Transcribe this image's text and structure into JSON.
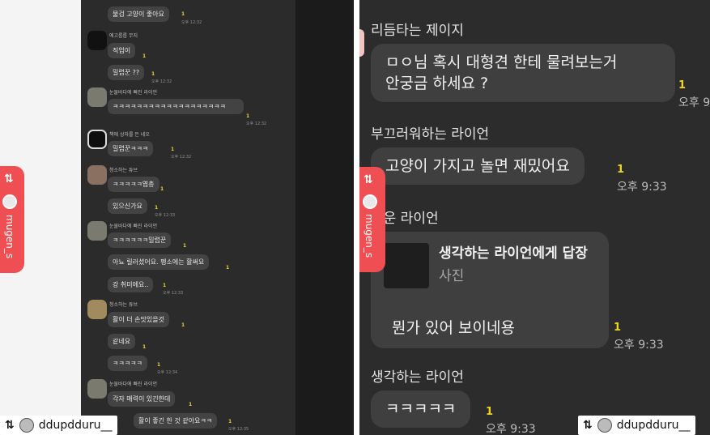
{
  "left": {
    "watermark": {
      "icon": "repost-icon",
      "handle": "mugen_s"
    },
    "repost_label": {
      "icon": "repost-icon",
      "handle": "ddupdduru__"
    },
    "items": [
      {
        "type": "msg",
        "text": "물검 고양이 좋아요",
        "unread": "1",
        "time": "오후 12:32"
      },
      {
        "type": "sender",
        "name": "예고롭롭 무지"
      },
      {
        "type": "msg",
        "text": "직업이",
        "unread": "1"
      },
      {
        "type": "msg",
        "text": "밀렵꾼 ??",
        "unread": "1",
        "time": "오후 12:32"
      },
      {
        "type": "sender",
        "name": "눈물바다에 빠진 라이언"
      },
      {
        "type": "msg",
        "text": "ㅋㅋㅋㅋㅋㅋㅋㅋㅋㅋㅋㅋㅋㅋㅋㅋㅋㅋㅋ",
        "unread": "1",
        "time": "오후 12:32"
      },
      {
        "type": "sender",
        "name": "책에 상자를 든 네오"
      },
      {
        "type": "msg",
        "text": "밀렵꾼ㅋㅋㅋ",
        "unread": "1",
        "time": "오후 12:32"
      },
      {
        "type": "sender",
        "name": "청소하는 튜브"
      },
      {
        "type": "msg",
        "text": "ㅋㅋㅋㅋㅋ엽총",
        "unread": "1"
      },
      {
        "type": "msg",
        "text": "있으신가요",
        "unread": "1",
        "time": "오후 12:33"
      },
      {
        "type": "sender",
        "name": "눈물바다에 빠진 라이언"
      },
      {
        "type": "msg",
        "text": "ㅋㅋㅋㅋㅋㅋ밀렵꾼",
        "unread": "1"
      },
      {
        "type": "msg",
        "text": "아뇨 릴러셨어요. 펭소에는 활써요",
        "unread": "1"
      },
      {
        "type": "msg",
        "text": "강 취미에요..",
        "unread": "1",
        "time": "오후 12:33"
      },
      {
        "type": "sender",
        "name": "청소하는 튜브"
      },
      {
        "type": "msg",
        "text": "활이 더 손맛있을것",
        "unread": "1"
      },
      {
        "type": "msg",
        "text": "같네요",
        "unread": "1"
      },
      {
        "type": "msg",
        "text": "ㅋㅋㅋㅋㅋ",
        "unread": "1",
        "time": "오후 12:34"
      },
      {
        "type": "sender",
        "name": "눈물바다에 빠진 라이언"
      },
      {
        "type": "msg",
        "text": "각자 매력이 있긴한데",
        "unread": "1"
      },
      {
        "type": "msg",
        "text": "활이 좋긴 한 것 같아요ㅋㅋ",
        "unread": "1",
        "time": "오후 12:35"
      }
    ]
  },
  "right": {
    "watermark": {
      "icon": "repost-icon",
      "handle": "mugen_s"
    },
    "repost_label": {
      "icon": "repost-icon",
      "handle": "ddupdduru__"
    },
    "items": [
      {
        "type": "sender",
        "name": "리듬타는 제이지"
      },
      {
        "type": "msg",
        "lines": [
          "ㅁㅇ님 혹시 대형견 한테 물려보는거",
          "안궁금 하세요 ?"
        ],
        "unread": "1",
        "time": "오후 9"
      },
      {
        "type": "sender",
        "name": "부끄러워하는 라이언"
      },
      {
        "type": "msg",
        "lines": [
          "고양이 가지고 놀면 재밌어요"
        ],
        "unread": "1",
        "time": "오후 9:33"
      },
      {
        "type": "sender",
        "name": "여운 라이언"
      },
      {
        "type": "reply",
        "reply_to": "생각하는 라이언에게 답장",
        "reply_kind": "사진",
        "text": "뭔가 있어 보이네용",
        "unread": "1",
        "time": "오후 9:33"
      },
      {
        "type": "sender",
        "name": "생각하는 라이언"
      },
      {
        "type": "msg",
        "lines": [
          "ㅋㅋㅋㅋㅋ"
        ],
        "unread": "1",
        "time": "오후 9:33"
      }
    ]
  }
}
